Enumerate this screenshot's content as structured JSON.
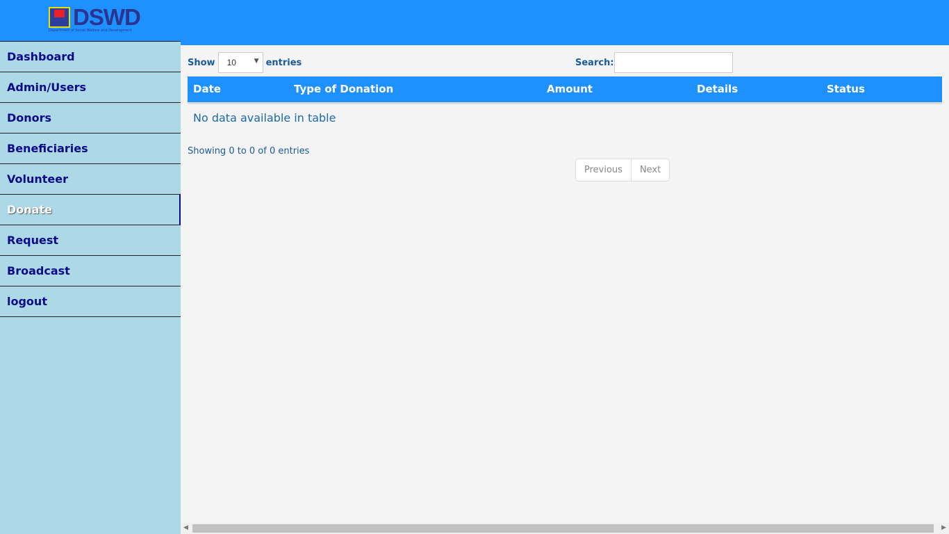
{
  "header": {
    "logo_text": "DSWD",
    "logo_subtitle": "Department of Social Welfare and Development",
    "color": "#1e90ff"
  },
  "sidebar": {
    "items": [
      {
        "label": "Dashboard"
      },
      {
        "label": "Admin/Users"
      },
      {
        "label": "Donors"
      },
      {
        "label": "Beneficiaries"
      },
      {
        "label": "Volunteer"
      },
      {
        "label": "Donate",
        "active": true
      },
      {
        "label": "Request"
      },
      {
        "label": "Broadcast"
      },
      {
        "label": "logout"
      }
    ]
  },
  "table_controls": {
    "show_label": "Show",
    "entries_value": "10",
    "entries_label": "entries",
    "search_label": "Search:",
    "search_value": ""
  },
  "table": {
    "columns": [
      "Date",
      "Type of Donation",
      "Amount",
      "Details",
      "Status"
    ],
    "empty_message": "No data available in table"
  },
  "footer": {
    "info": "Showing 0 to 0 of 0 entries",
    "previous": "Previous",
    "next": "Next"
  }
}
